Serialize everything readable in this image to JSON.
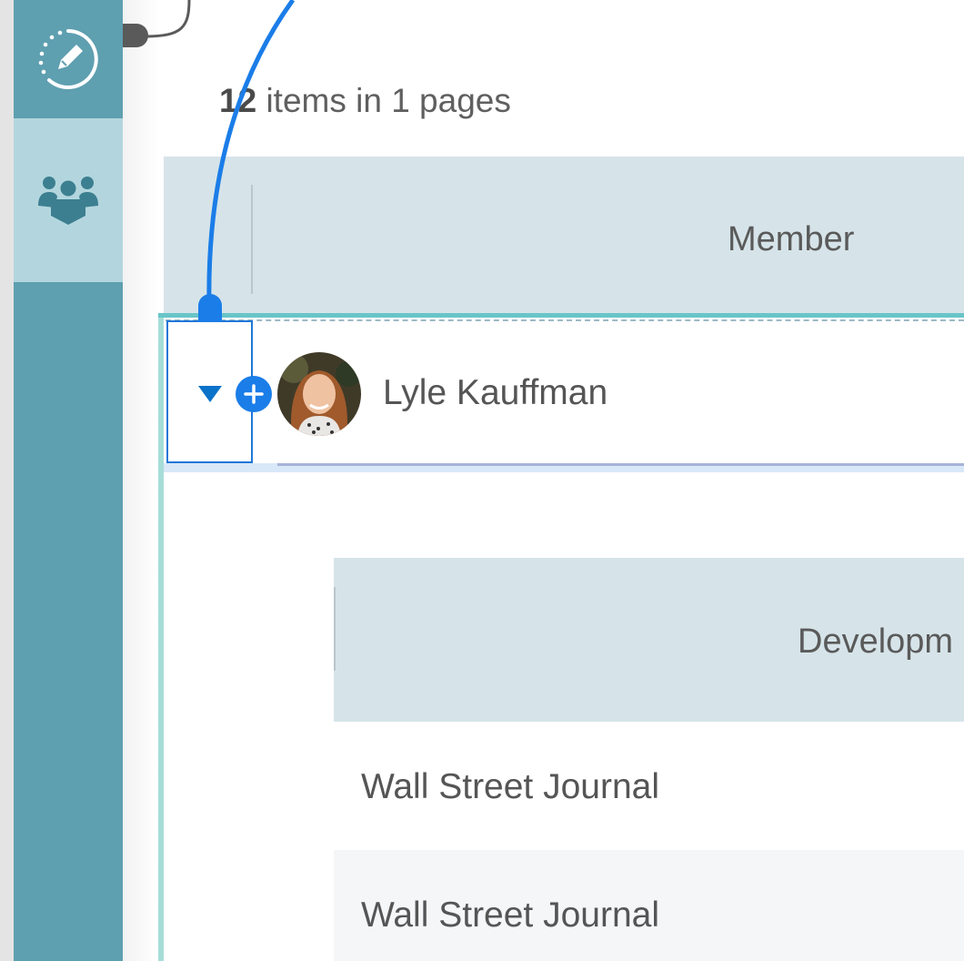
{
  "sidebar": {
    "items": [
      {
        "name": "edit",
        "icon": "edit-icon"
      },
      {
        "name": "team",
        "icon": "team-icon",
        "active": true
      }
    ]
  },
  "summary": {
    "count": "12",
    "rest": "items in 1 pages"
  },
  "table": {
    "header": {
      "member": "Member"
    },
    "rows": [
      {
        "name": "Lyle Kauffman",
        "expanded": true,
        "nested": {
          "header": "Developm",
          "rows": [
            {
              "publication": "Wall Street Journal"
            },
            {
              "publication": "Wall Street Journal"
            }
          ]
        }
      }
    ]
  },
  "colors": {
    "sidebar": "#5e9fb0",
    "sidebar_active": "#b3d6de",
    "header_bg": "#d6e4e9",
    "accent": "#1b7de8",
    "row_highlight": "#69c5c8"
  }
}
